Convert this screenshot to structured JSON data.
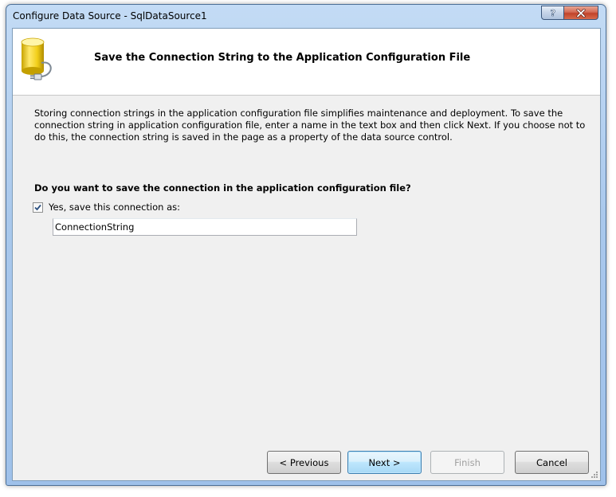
{
  "window": {
    "title": "Configure Data Source - SqlDataSource1",
    "help_label": "?",
    "close_label": "X"
  },
  "header": {
    "title": "Save the Connection String to the Application Configuration File",
    "icon": "database-connection-icon"
  },
  "body": {
    "description": "Storing connection strings in the application configuration file simplifies maintenance and deployment. To save the connection string in application configuration file, enter a name in the text box and then click Next. If you choose not to do this, the connection string is saved in the page as a property of the data source control.",
    "question": "Do you want to save the connection in the application configuration file?",
    "checkbox_label": "Yes, save this connection as:",
    "checkbox_checked": true,
    "connection_name": "ConnectionString"
  },
  "buttons": {
    "previous": "< Previous",
    "next": "Next >",
    "finish": "Finish",
    "cancel": "Cancel"
  },
  "colors": {
    "titlebar": "#a9c8ec",
    "client": "#f0f0f0",
    "close": "#c1432a"
  }
}
